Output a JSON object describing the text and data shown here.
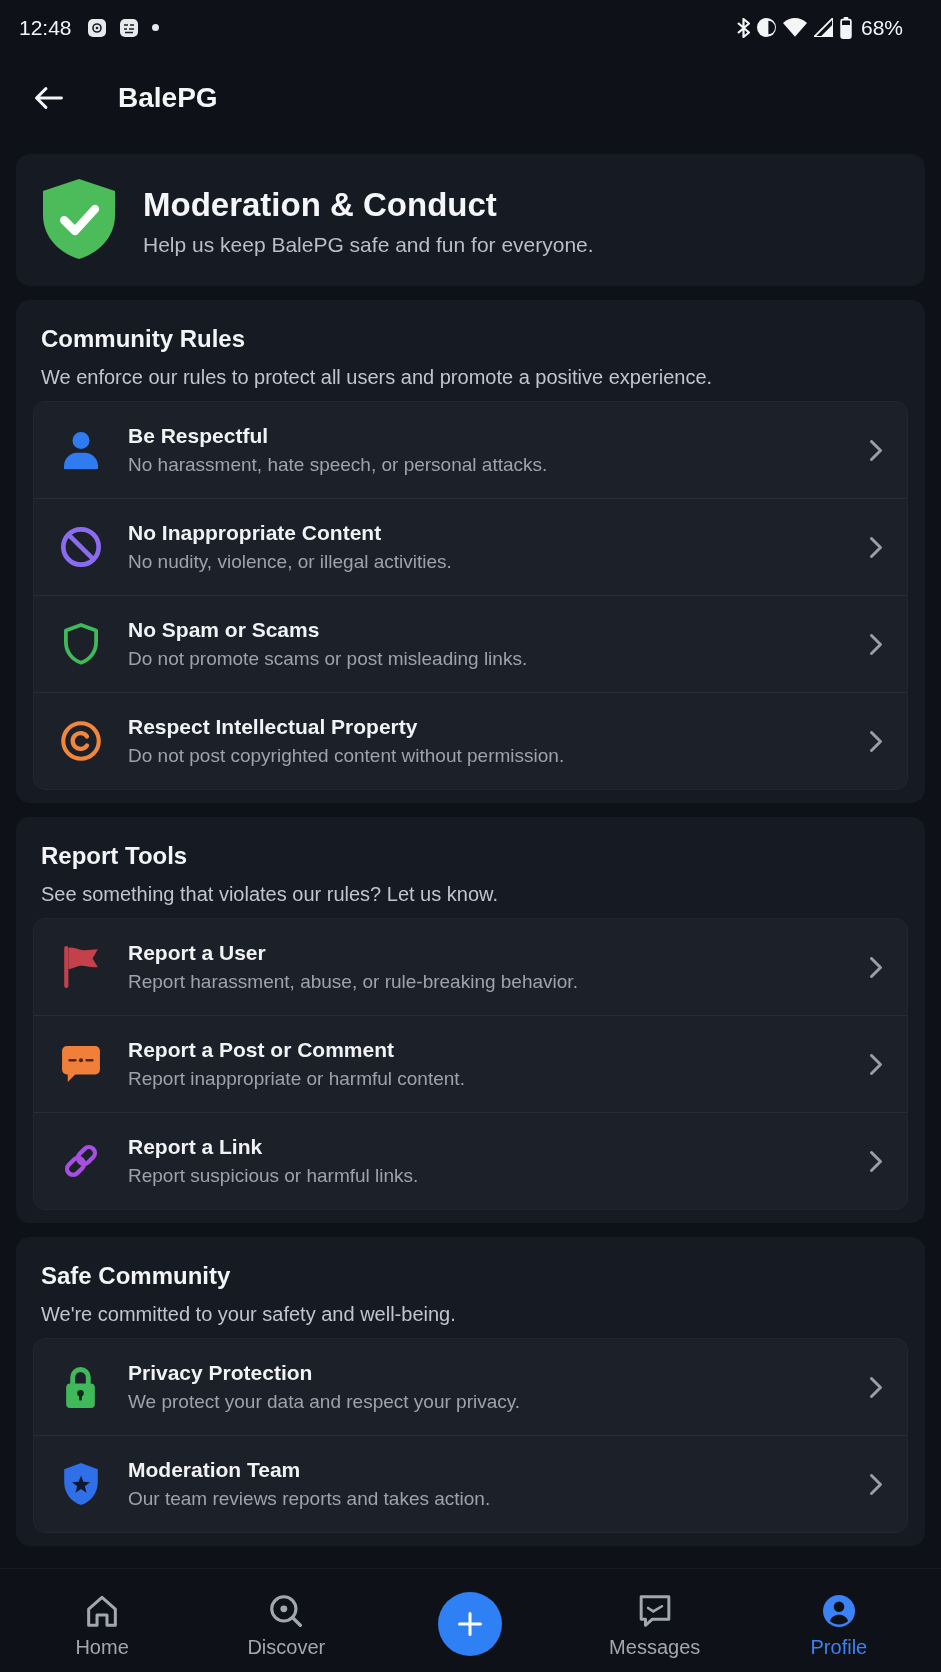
{
  "status_bar": {
    "time": "12:48",
    "battery": "68%"
  },
  "app_bar": {
    "title": "BalePG"
  },
  "intro_card": {
    "title": "Moderation & Conduct",
    "subtitle": "Help us keep BalePG safe and fun for everyone."
  },
  "sections": [
    {
      "title": "Community Rules",
      "subtitle": "We enforce our rules to protect all users and promote a positive experience.",
      "items": [
        {
          "title": "Be Respectful",
          "description": "No harassment, hate speech, or personal attacks."
        },
        {
          "title": "No Inappropriate Content",
          "description": "No nudity, violence, or illegal activities."
        },
        {
          "title": "No Spam or Scams",
          "description": "Do not promote scams or post misleading links."
        },
        {
          "title": "Respect Intellectual Property",
          "description": "Do not post copyrighted content without permission."
        }
      ]
    },
    {
      "title": "Report Tools",
      "subtitle": "See something that violates our rules? Let us know.",
      "items": [
        {
          "title": "Report a User",
          "description": "Report harassment, abuse, or rule-breaking behavior."
        },
        {
          "title": "Report a Post or Comment",
          "description": "Report inappropriate or harmful content."
        },
        {
          "title": "Report a Link",
          "description": "Report suspicious or harmful links."
        }
      ]
    },
    {
      "title": "Safe Community",
      "subtitle": "We're committed to your safety and well-being.",
      "items": [
        {
          "title": "Privacy Protection",
          "description": "We protect your data and respect your privacy."
        },
        {
          "title": "Moderation Team",
          "description": "Our team reviews reports and takes action."
        }
      ]
    }
  ],
  "bottom_nav": [
    {
      "kind": "tab",
      "label": "Home",
      "selected": false
    },
    {
      "kind": "tab",
      "label": "Discover",
      "selected": false
    },
    {
      "kind": "create"
    },
    {
      "kind": "tab",
      "label": "Messages",
      "selected": false
    },
    {
      "kind": "tab",
      "label": "Profile",
      "selected": true
    }
  ]
}
